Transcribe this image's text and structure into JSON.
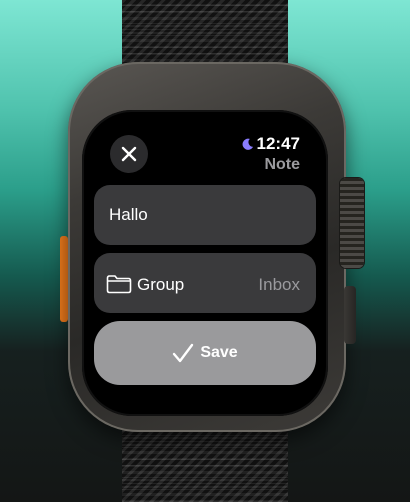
{
  "status": {
    "time": "12:47",
    "moon_icon": "moon-icon"
  },
  "header": {
    "title": "Note"
  },
  "form": {
    "text_value": "Hallo",
    "group_label": "Group",
    "group_value": "Inbox",
    "save_label": "Save"
  },
  "colors": {
    "action_button": "#f07b1c",
    "card": "#3a3a3c",
    "save_button": "#9a9a9c"
  }
}
